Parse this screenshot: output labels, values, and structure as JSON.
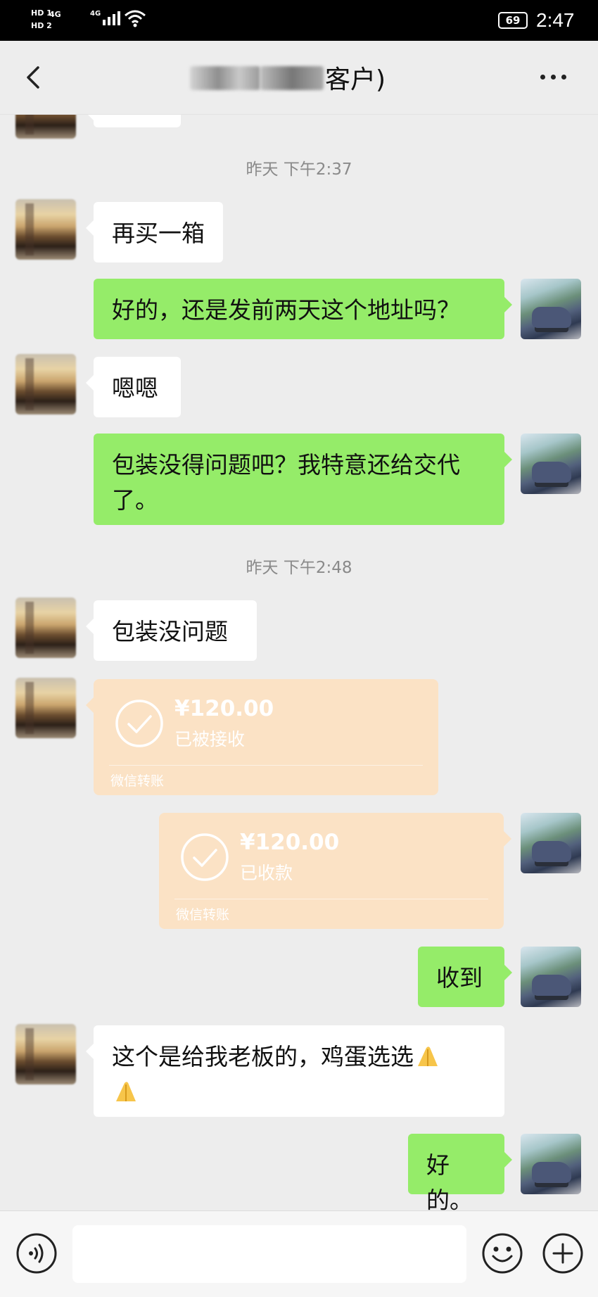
{
  "status_bar": {
    "hd1": "HD 1",
    "hd2": "HD 2",
    "net1": "4G",
    "net2": "4G",
    "battery": "69",
    "time": "2:47"
  },
  "header": {
    "title_visible_suffix": "客户)"
  },
  "messages": {
    "ts1": "昨天 下午2:37",
    "m1": "再买一箱",
    "m2": "好的，还是发前两天这个地址吗？",
    "m3": "嗯嗯",
    "m4a": "包装没得问题吧？我特意还给交代",
    "m4b": "了。",
    "ts2": "昨天 下午2:48",
    "m5": "包装没问题",
    "t1": {
      "amount": "¥120.00",
      "status": "已被接收",
      "footer": "微信转账"
    },
    "t2": {
      "amount": "¥120.00",
      "status": "已收款",
      "footer": "微信转账"
    },
    "m6": "收到",
    "m7a": "这个是给我老板的，鸡蛋选选",
    "m8": "好的。"
  },
  "input": {
    "placeholder": ""
  },
  "colors": {
    "sent_bubble": "#95ec69",
    "received_bubble": "#ffffff",
    "transfer_bubble": "#fbe2c5",
    "background": "#ededed"
  }
}
